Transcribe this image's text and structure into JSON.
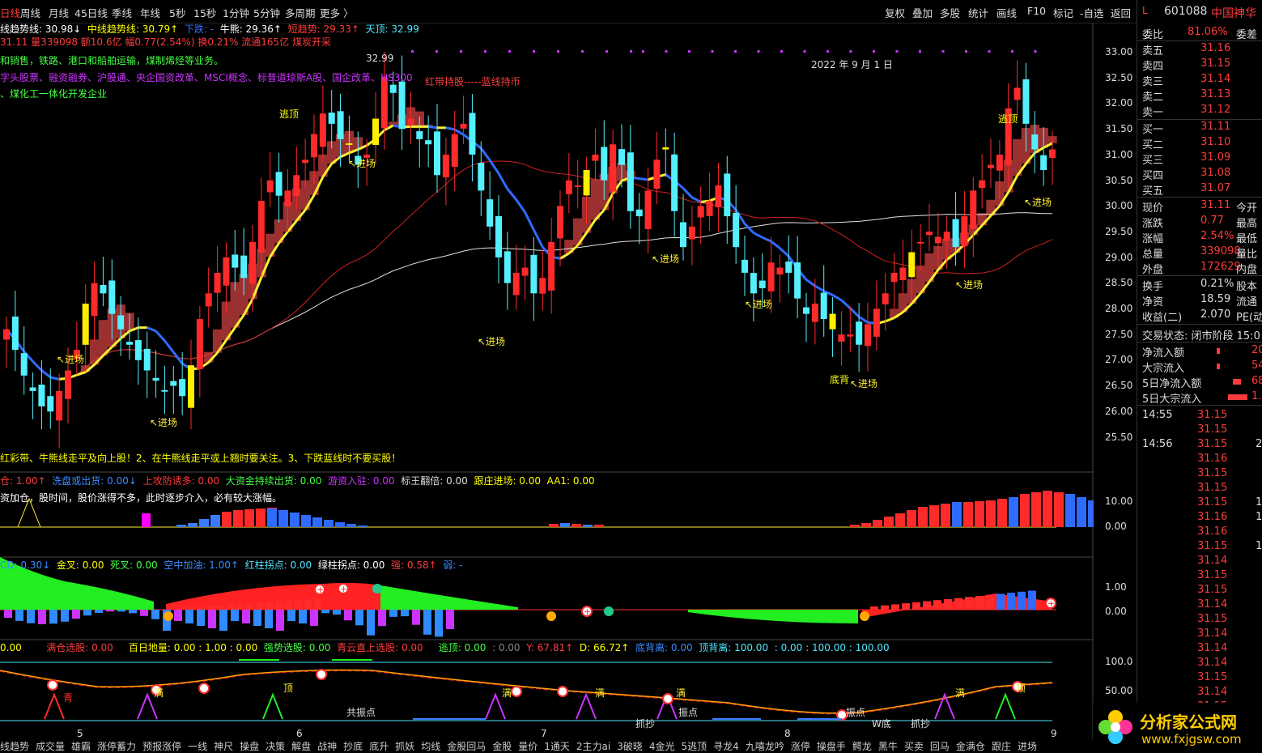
{
  "topbar": {
    "tabs": [
      "日线",
      "周线",
      "月线",
      "45日线",
      "季线",
      "年线",
      "5秒",
      "15秒",
      "1分钟",
      "5分钟",
      "多周期",
      "更多 〉"
    ],
    "tools": [
      "复权",
      "叠加",
      "多股",
      "统计",
      "画线",
      "F10",
      "标记",
      "-自选",
      "返回"
    ]
  },
  "indicator_line1": {
    "a": "线趋势线: 30.98↓",
    "b": "中线趋势线: 30.79↑",
    "c": "下跌: -",
    "d": "牛熊: 29.36↑",
    "e": "短趋势: 29.33↑",
    "f": "天顶: 32.99"
  },
  "indicator_line2": "31.11 量339098 额10.6亿 幅0.77(2.54%) 换0.21% 流通165亿 煤炭开采",
  "info1": "和销售，铁路、港口和船舶运输，煤制烯烃等业务。",
  "info2": "字头股票、融资融券、沪股通、央企国资改革、MSCI概念、标普道琼斯A股、国企改革、HS300",
  "info3": "、煤化工一体化开发企业",
  "price_high_label": "32.99",
  "date_label": "2022 年 9 月 1 日",
  "hongdai": "红带持股-----蓝线持币",
  "price_low_label": "25.4",
  "signals": {
    "taodin": "逃顶",
    "jinchang": "进场",
    "dibei": "底背",
    "tuohuo": "逃顶",
    "jinchang2": "进场"
  },
  "main_note": "红彩带、牛熊线走平及向上股！2、在牛熊线走平或上翘时要关注。3、下跌蓝线时不要买股！",
  "main_axis": [
    "33.00",
    "32.50",
    "32.00",
    "31.50",
    "31.00",
    "30.50",
    "30.00",
    "29.50",
    "29.00",
    "28.50",
    "28.00",
    "27.50",
    "27.00",
    "26.50",
    "26.00",
    "25.50"
  ],
  "sub1_legend": {
    "a": "仓: 1.00↑",
    "b": "洗盘或出货: 0.00↓",
    "c": "上攻防诱多: 0.00",
    "d": "大资金持续出货: 0.00",
    "e": "游资入驻: 0.00",
    "f": "标王翻倍: 0.00",
    "g": "跟庄进场: 0.00",
    "h": "AA1: 0.00"
  },
  "sub1_note": "资加仓，股时间，股价涨得不多，此时逐步介入，必有较大涨幅。",
  "sub1_axis": [
    "10.00",
    "0.00"
  ],
  "sub2_legend": {
    "a": "CD: 0.30↓",
    "b": "金叉: 0.00",
    "c": "死叉: 0.00",
    "d": "空中加油: 1.00↑",
    "e": "红柱拐点: 0.00",
    "f": "绿柱拐点: 0.00",
    "g": "强: 0.58↑",
    "h": "弱: -"
  },
  "sub2_axis": [
    "1.00",
    "0.00"
  ],
  "sub3_legend": {
    "a": "0.00",
    "b": "满仓选股: 0.00",
    "c": "百日地量: 0.00 : 1.00 : 0.00",
    "d": "强势选股: 0.00",
    "e": "青云直上选股: 0.00",
    "f": "逃顶: 0.00",
    "g": ": 0.00",
    "h": "Y: 67.81↑",
    "i": "D: 66.72↑",
    "j": "底背离: 0.00",
    "k": "顶背离: 100.00",
    "l": ": 0.00 : 100.00 : 100.00"
  },
  "sub3_axis": [
    "100.0",
    "50.00"
  ],
  "x_axis": [
    "5",
    "6",
    "7",
    "8",
    "9"
  ],
  "sub3_labels": {
    "qing": "青",
    "man": "满",
    "ding": "顶",
    "zhen": "共振点",
    "zhen2": "振点",
    "wdi": "W底",
    "shi": "抓抄",
    "zhen3": "振点"
  },
  "bottom_tabs": [
    "线趋势",
    "成交量",
    "雄霸",
    "涨停蓄力",
    "预报涨停",
    "一线",
    "神尺",
    "操盘",
    "决策",
    "解盘",
    "战神",
    "抄底",
    "底升",
    "抓妖",
    "均线",
    "金股回马",
    "金股",
    "量价",
    "1通天",
    "2主力ai",
    "3破晓",
    "4金光",
    "5逃顶",
    "寻龙4",
    "九嘻龙吟",
    "涨停",
    "操盘手",
    "鳄龙",
    "黑牛",
    "买卖",
    "回马",
    "金满仓",
    "跟庄",
    "进场"
  ],
  "right_panel": {
    "code": "601088",
    "name": "中国神华",
    "webi_label": "委比",
    "webi": "81.06%",
    "wecha": "委差",
    "asks": [
      {
        "k": "卖五",
        "v": "31.16"
      },
      {
        "k": "卖四",
        "v": "31.15"
      },
      {
        "k": "卖三",
        "v": "31.14"
      },
      {
        "k": "卖二",
        "v": "31.13"
      },
      {
        "k": "卖一",
        "v": "31.12"
      }
    ],
    "bids": [
      {
        "k": "买一",
        "v": "31.11"
      },
      {
        "k": "买二",
        "v": "31.10"
      },
      {
        "k": "买三",
        "v": "31.09"
      },
      {
        "k": "买四",
        "v": "31.08"
      },
      {
        "k": "买五",
        "v": "31.07"
      }
    ],
    "quote": [
      {
        "k": "现价",
        "v": "31.11",
        "k2": "今开"
      },
      {
        "k": "涨跌",
        "v": "0.77",
        "k2": "最高"
      },
      {
        "k": "涨幅",
        "v": "2.54%",
        "k2": "最低"
      },
      {
        "k": "总量",
        "v": "339098",
        "k2": "量比"
      },
      {
        "k": "外盘",
        "v": "172629",
        "k2": "内盘"
      }
    ],
    "stats": [
      {
        "k": "换手",
        "v": "0.21%",
        "k2": "股本"
      },
      {
        "k": "净资",
        "v": "18.59",
        "k2": "流通"
      },
      {
        "k": "收益(二)",
        "v": "2.070",
        "k2": "PE(动"
      }
    ],
    "state": "交易状态: 闭市阶段 15:0",
    "flows": [
      {
        "k": "净流入额",
        "v": "20"
      },
      {
        "k": "大宗流入",
        "v": "54"
      },
      {
        "k": "5日净流入额",
        "v": "68"
      },
      {
        "k": "5日大宗流入",
        "v": "1."
      }
    ],
    "ticks": [
      {
        "t": "14:55",
        "p": "31.15",
        "n": ""
      },
      {
        "t": "",
        "p": "31.15",
        "n": ""
      },
      {
        "t": "14:56",
        "p": "31.15",
        "n": "2"
      },
      {
        "t": "",
        "p": "31.16",
        "n": ""
      },
      {
        "t": "",
        "p": "31.15",
        "n": ""
      },
      {
        "t": "",
        "p": "31.15",
        "n": ""
      },
      {
        "t": "",
        "p": "31.15",
        "n": "1"
      },
      {
        "t": "",
        "p": "31.16",
        "n": "1"
      },
      {
        "t": "",
        "p": "31.16",
        "n": ""
      },
      {
        "t": "",
        "p": "31.15",
        "n": "1"
      },
      {
        "t": "",
        "p": "31.14",
        "n": ""
      },
      {
        "t": "",
        "p": "31.15",
        "n": ""
      },
      {
        "t": "",
        "p": "31.15",
        "n": ""
      },
      {
        "t": "",
        "p": "31.14",
        "n": ""
      },
      {
        "t": "",
        "p": "31.15",
        "n": ""
      },
      {
        "t": "",
        "p": "31.14",
        "n": ""
      },
      {
        "t": "",
        "p": "31.14",
        "n": ""
      },
      {
        "t": "",
        "p": "31.14",
        "n": ""
      },
      {
        "t": "",
        "p": "31.15",
        "n": ""
      },
      {
        "t": "",
        "p": "31.14",
        "n": ""
      },
      {
        "t": "",
        "p": "31.15",
        "n": ""
      },
      {
        "t": "",
        "p": "31.15",
        "n": ""
      },
      {
        "t": "",
        "p": "31.15",
        "n": ""
      }
    ]
  },
  "watermark": {
    "cn": "分析家公式网",
    "url": "www.fxjgsw.com"
  }
}
